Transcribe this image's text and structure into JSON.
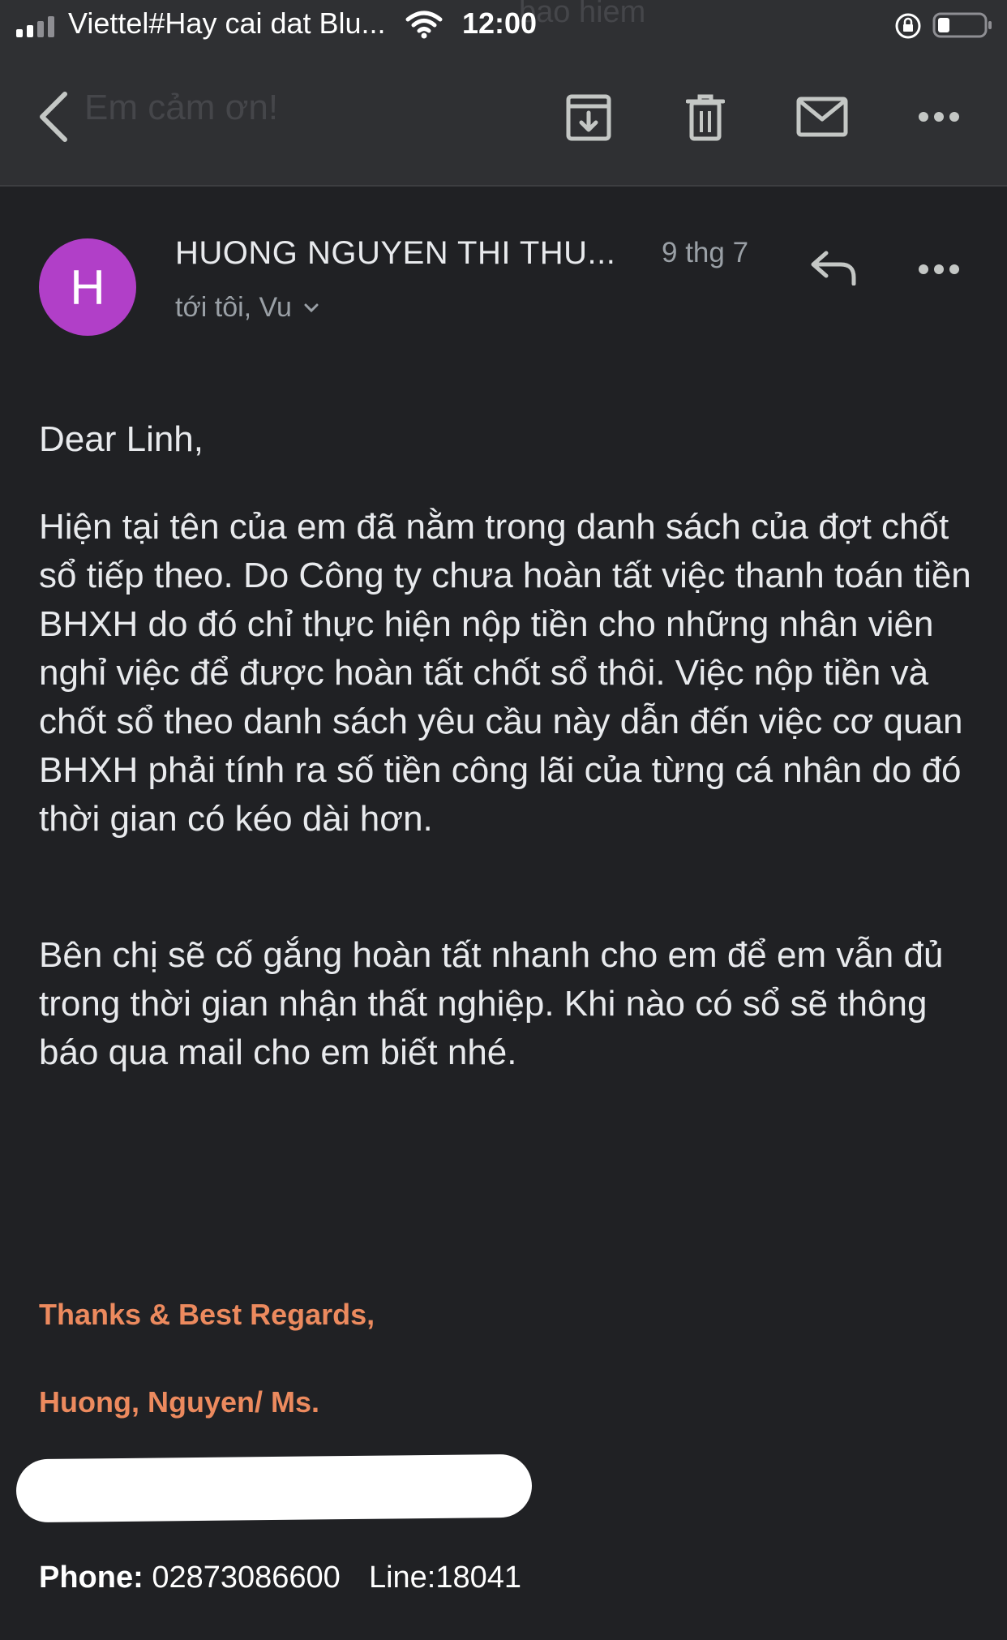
{
  "status_bar": {
    "carrier": "Viettel#Hay cai dat Blu...",
    "time": "12:00"
  },
  "toolbar": {
    "ghost_subject": "Em cảm ơn!",
    "ghost_top": "bao hiem"
  },
  "email": {
    "avatar_letter": "H",
    "avatar_color": "#b13fc8",
    "sender": "HUONG NGUYEN THI THU...",
    "date": "9 thg 7",
    "recipients": "tới tôi, Vu",
    "greeting": "Dear Linh,",
    "paragraph1": "Hiện tại tên của em đã nằm trong danh sách của đợt chốt sổ tiếp theo. Do Công ty chưa hoàn tất việc thanh toán tiền BHXH do đó chỉ thực hiện nộp tiền cho những nhân viên nghỉ việc để được hoàn tất chốt sổ thôi. Việc nộp tiền và chốt sổ theo danh sách yêu cầu này dẫn đến việc cơ quan BHXH phải tính ra số tiền công lãi của từng cá nhân do đó thời gian có kéo dài hơn.",
    "paragraph2": "Bên chị sẽ cố gắng hoàn tất nhanh cho em để em vẫn đủ trong thời gian nhận thất nghiệp. Khi nào có sổ sẽ thông báo qua mail cho em biết nhé.",
    "signature_line1": "Thanks & Best Regards,",
    "signature_line2": "Huong, Nguyen/ Ms.",
    "signature_color": "#ec8a5e",
    "phone_label": "Phone:",
    "phone_value": "02873086600",
    "line_value": "Line:18041"
  }
}
